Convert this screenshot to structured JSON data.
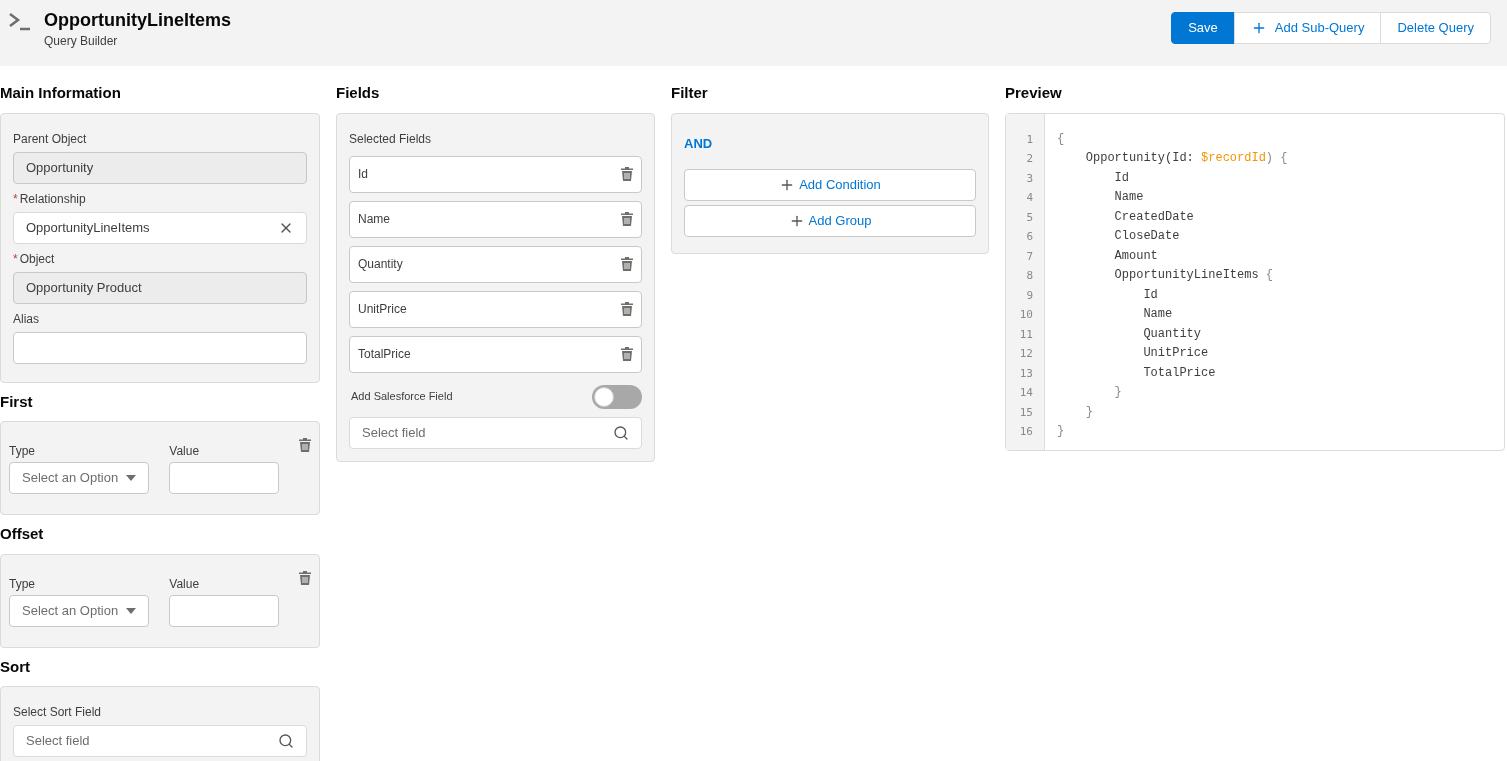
{
  "header": {
    "title": "OpportunityLineItems",
    "subtitle": "Query Builder",
    "buttons": [
      {
        "label": "Save",
        "kind": "primary"
      },
      {
        "label": "Add Sub-Query",
        "kind": "add"
      },
      {
        "label": "Delete Query",
        "kind": "plain"
      }
    ]
  },
  "main_information": {
    "heading": "Main Information",
    "fields": [
      {
        "label": "Parent Object",
        "value": "Opportunity",
        "required": false,
        "kind": "readonly"
      },
      {
        "label": "Relationship",
        "value": "OpportunityLineItems",
        "required": true,
        "kind": "lookup"
      },
      {
        "label": "Object",
        "value": "Opportunity Product",
        "required": true,
        "kind": "readonly"
      },
      {
        "label": "Alias",
        "required": false,
        "kind": "input"
      }
    ],
    "required_symbol": "*"
  },
  "limits": [
    {
      "heading": "First",
      "type_label": "Type",
      "type_placeholder": "Select an Option",
      "value_label": "Value"
    },
    {
      "heading": "Offset",
      "type_label": "Type",
      "type_placeholder": "Select an Option",
      "value_label": "Value"
    }
  ],
  "sort": {
    "heading": "Sort",
    "label": "Select Sort Field",
    "placeholder": "Select field"
  },
  "fields": {
    "heading": "Fields",
    "label": "Selected Fields",
    "items": [
      "Id",
      "Name",
      "Quantity",
      "UnitPrice",
      "TotalPrice"
    ],
    "toggle_label": "Add Salesforce Field",
    "toggle_on": false,
    "search_placeholder": "Select field"
  },
  "filter": {
    "heading": "Filter",
    "operator": "AND",
    "buttons": [
      "Add Condition",
      "Add Group"
    ]
  },
  "preview": {
    "heading": "Preview",
    "lines": [
      {
        "number": "1",
        "segments": [
          {
            "text": "{",
            "kind": "brace"
          }
        ]
      },
      {
        "number": "2",
        "segments": [
          {
            "text": "    Opportunity(Id: ",
            "kind": "plain"
          },
          {
            "text": "$recordId",
            "kind": "variable"
          },
          {
            "text": ") {",
            "kind": "brace"
          }
        ]
      },
      {
        "number": "3",
        "segments": [
          {
            "text": "        Id",
            "kind": "plain"
          }
        ]
      },
      {
        "number": "4",
        "segments": [
          {
            "text": "        Name",
            "kind": "plain"
          }
        ]
      },
      {
        "number": "5",
        "segments": [
          {
            "text": "        CreatedDate",
            "kind": "plain"
          }
        ]
      },
      {
        "number": "6",
        "segments": [
          {
            "text": "        CloseDate",
            "kind": "plain"
          }
        ]
      },
      {
        "number": "7",
        "segments": [
          {
            "text": "        Amount",
            "kind": "plain"
          }
        ]
      },
      {
        "number": "8",
        "segments": [
          {
            "text": "        OpportunityLineItems",
            "kind": "plain"
          },
          {
            "text": " {",
            "kind": "brace"
          }
        ]
      },
      {
        "number": "9",
        "segments": [
          {
            "text": "            Id",
            "kind": "plain"
          }
        ]
      },
      {
        "number": "10",
        "segments": [
          {
            "text": "            Name",
            "kind": "plain"
          }
        ]
      },
      {
        "number": "11",
        "segments": [
          {
            "text": "            Quantity",
            "kind": "plain"
          }
        ]
      },
      {
        "number": "12",
        "segments": [
          {
            "text": "            UnitPrice",
            "kind": "plain"
          }
        ]
      },
      {
        "number": "13",
        "segments": [
          {
            "text": "            TotalPrice",
            "kind": "plain"
          }
        ]
      },
      {
        "number": "14",
        "segments": [
          {
            "text": "        }",
            "kind": "brace"
          }
        ]
      },
      {
        "number": "15",
        "segments": [
          {
            "text": "    }",
            "kind": "brace"
          }
        ]
      },
      {
        "number": "16",
        "segments": [
          {
            "text": "}",
            "kind": "brace"
          }
        ]
      }
    ]
  }
}
